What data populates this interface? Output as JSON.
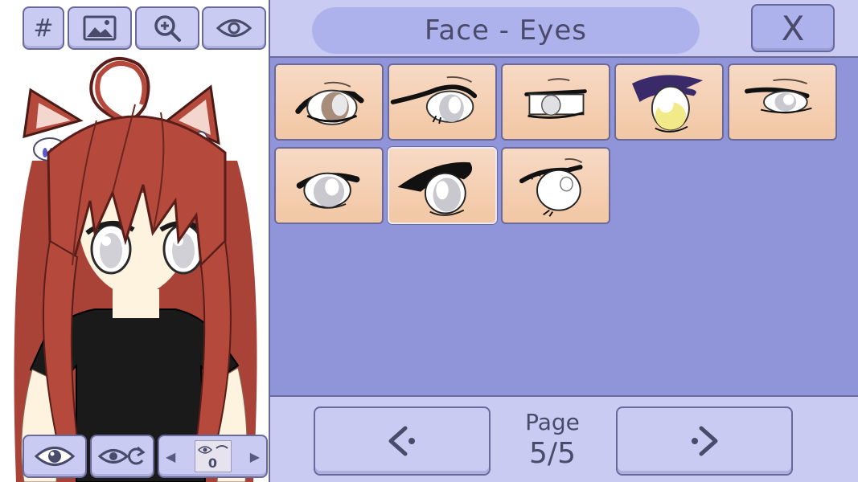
{
  "toolbar": {
    "grid_label": "#",
    "icons": [
      "image-icon",
      "zoom-in-icon",
      "eye-icon"
    ]
  },
  "header": {
    "title": "Face - Eyes",
    "close_label": "X"
  },
  "eyes": {
    "tile_count": 8,
    "selected_index": 6
  },
  "pagination": {
    "page_label": "Page",
    "page_value": "5/5"
  },
  "bottom_toolbar": {
    "layer_value": "0"
  },
  "colors": {
    "panel": "#c9cbf3",
    "content_bg": "#8f95d8",
    "border": "#6a6a9a",
    "text": "#4a4a6a",
    "hair": "#b54a3c",
    "tile_top": "#f7d9c4",
    "tile_bottom": "#f2c7a4"
  }
}
